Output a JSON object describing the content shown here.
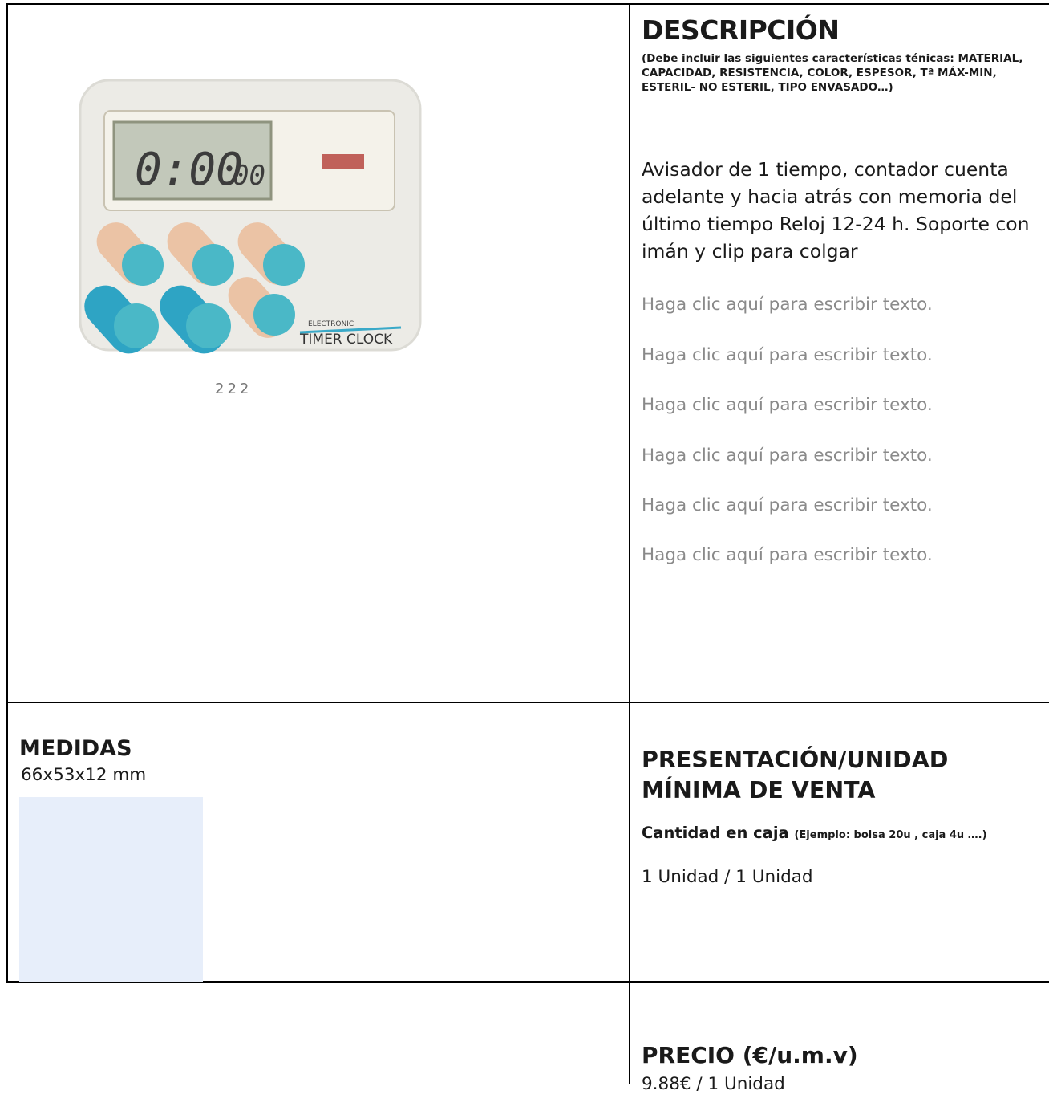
{
  "description": {
    "title": "DESCRIPCIÓN",
    "hint": "(Debe incluir las siguientes características ténicas: MATERIAL, CAPACIDAD, RESISTENCIA, COLOR, ESPESOR, Tª MÁX-MIN, ESTERIL- NO ESTERIL, TIPO ENVASADO…)",
    "body": "Avisador de 1 tiempo, contador cuenta adelante y hacia atrás con memoria del último tiempo Reloj 12-24 h. Soporte con imán y clip para colgar",
    "placeholders": [
      "Haga clic aquí para escribir texto.",
      "Haga clic aquí para escribir texto.",
      "Haga clic aquí para escribir texto.",
      "Haga clic aquí para escribir texto.",
      "Haga clic aquí para escribir texto.",
      "Haga clic aquí para escribir texto."
    ]
  },
  "product_image": {
    "display_time": "0:00",
    "display_secs": "00",
    "brand_small": "ELECTRONIC",
    "brand_large": "TIMER CLOCK",
    "caption": "222"
  },
  "medidas": {
    "title": "MEDIDAS",
    "value": "66x53x12 mm"
  },
  "presentacion": {
    "title": "PRESENTACIÓN/UNIDAD MÍNIMA DE VENTA",
    "subtitle": "Cantidad en caja",
    "subtitle_hint": "(Ejemplo: bolsa 20u , caja 4u ….)",
    "value": "1 Unidad / 1 Unidad"
  },
  "precio": {
    "title": "PRECIO (€/u.m.v)",
    "value": "9.88€ / 1 Unidad"
  }
}
